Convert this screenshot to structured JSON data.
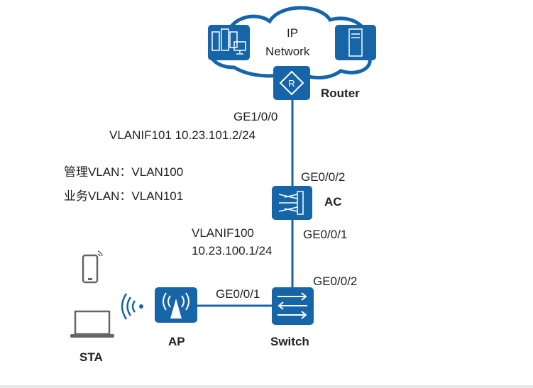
{
  "colors": {
    "device": "#1565a8",
    "link": "#1565a8",
    "peripheral": "#666666"
  },
  "cloud": {
    "label_line1": "IP",
    "label_line2": "Network"
  },
  "nodes": {
    "router": "Router",
    "ac": "AC",
    "switch": "Switch",
    "ap": "AP",
    "sta": "STA"
  },
  "interfaces": {
    "router_port": "GE1/0/0",
    "router_vlanif": "VLANIF101 10.23.101.2/24",
    "ac_up": "GE0/0/2",
    "ac_down": "GE0/0/1",
    "ac_vlanif_name": "VLANIF100",
    "ac_vlanif_ip": "10.23.100.1/24",
    "switch_up": "GE0/0/2",
    "switch_ap": "GE0/0/1"
  },
  "vlans": {
    "mgmt": "管理VLAN：VLAN100",
    "service": "业务VLAN：VLAN101"
  }
}
